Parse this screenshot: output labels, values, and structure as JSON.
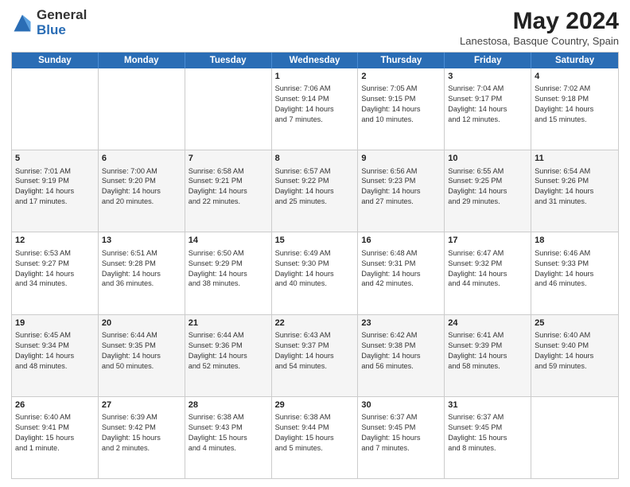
{
  "header": {
    "logo_general": "General",
    "logo_blue": "Blue",
    "title": "May 2024",
    "location": "Lanestosa, Basque Country, Spain"
  },
  "days_of_week": [
    "Sunday",
    "Monday",
    "Tuesday",
    "Wednesday",
    "Thursday",
    "Friday",
    "Saturday"
  ],
  "weeks": [
    {
      "alt": false,
      "cells": [
        {
          "day": "",
          "content": ""
        },
        {
          "day": "",
          "content": ""
        },
        {
          "day": "",
          "content": ""
        },
        {
          "day": "1",
          "content": "Sunrise: 7:06 AM\nSunset: 9:14 PM\nDaylight: 14 hours\nand 7 minutes."
        },
        {
          "day": "2",
          "content": "Sunrise: 7:05 AM\nSunset: 9:15 PM\nDaylight: 14 hours\nand 10 minutes."
        },
        {
          "day": "3",
          "content": "Sunrise: 7:04 AM\nSunset: 9:17 PM\nDaylight: 14 hours\nand 12 minutes."
        },
        {
          "day": "4",
          "content": "Sunrise: 7:02 AM\nSunset: 9:18 PM\nDaylight: 14 hours\nand 15 minutes."
        }
      ]
    },
    {
      "alt": true,
      "cells": [
        {
          "day": "5",
          "content": "Sunrise: 7:01 AM\nSunset: 9:19 PM\nDaylight: 14 hours\nand 17 minutes."
        },
        {
          "day": "6",
          "content": "Sunrise: 7:00 AM\nSunset: 9:20 PM\nDaylight: 14 hours\nand 20 minutes."
        },
        {
          "day": "7",
          "content": "Sunrise: 6:58 AM\nSunset: 9:21 PM\nDaylight: 14 hours\nand 22 minutes."
        },
        {
          "day": "8",
          "content": "Sunrise: 6:57 AM\nSunset: 9:22 PM\nDaylight: 14 hours\nand 25 minutes."
        },
        {
          "day": "9",
          "content": "Sunrise: 6:56 AM\nSunset: 9:23 PM\nDaylight: 14 hours\nand 27 minutes."
        },
        {
          "day": "10",
          "content": "Sunrise: 6:55 AM\nSunset: 9:25 PM\nDaylight: 14 hours\nand 29 minutes."
        },
        {
          "day": "11",
          "content": "Sunrise: 6:54 AM\nSunset: 9:26 PM\nDaylight: 14 hours\nand 31 minutes."
        }
      ]
    },
    {
      "alt": false,
      "cells": [
        {
          "day": "12",
          "content": "Sunrise: 6:53 AM\nSunset: 9:27 PM\nDaylight: 14 hours\nand 34 minutes."
        },
        {
          "day": "13",
          "content": "Sunrise: 6:51 AM\nSunset: 9:28 PM\nDaylight: 14 hours\nand 36 minutes."
        },
        {
          "day": "14",
          "content": "Sunrise: 6:50 AM\nSunset: 9:29 PM\nDaylight: 14 hours\nand 38 minutes."
        },
        {
          "day": "15",
          "content": "Sunrise: 6:49 AM\nSunset: 9:30 PM\nDaylight: 14 hours\nand 40 minutes."
        },
        {
          "day": "16",
          "content": "Sunrise: 6:48 AM\nSunset: 9:31 PM\nDaylight: 14 hours\nand 42 minutes."
        },
        {
          "day": "17",
          "content": "Sunrise: 6:47 AM\nSunset: 9:32 PM\nDaylight: 14 hours\nand 44 minutes."
        },
        {
          "day": "18",
          "content": "Sunrise: 6:46 AM\nSunset: 9:33 PM\nDaylight: 14 hours\nand 46 minutes."
        }
      ]
    },
    {
      "alt": true,
      "cells": [
        {
          "day": "19",
          "content": "Sunrise: 6:45 AM\nSunset: 9:34 PM\nDaylight: 14 hours\nand 48 minutes."
        },
        {
          "day": "20",
          "content": "Sunrise: 6:44 AM\nSunset: 9:35 PM\nDaylight: 14 hours\nand 50 minutes."
        },
        {
          "day": "21",
          "content": "Sunrise: 6:44 AM\nSunset: 9:36 PM\nDaylight: 14 hours\nand 52 minutes."
        },
        {
          "day": "22",
          "content": "Sunrise: 6:43 AM\nSunset: 9:37 PM\nDaylight: 14 hours\nand 54 minutes."
        },
        {
          "day": "23",
          "content": "Sunrise: 6:42 AM\nSunset: 9:38 PM\nDaylight: 14 hours\nand 56 minutes."
        },
        {
          "day": "24",
          "content": "Sunrise: 6:41 AM\nSunset: 9:39 PM\nDaylight: 14 hours\nand 58 minutes."
        },
        {
          "day": "25",
          "content": "Sunrise: 6:40 AM\nSunset: 9:40 PM\nDaylight: 14 hours\nand 59 minutes."
        }
      ]
    },
    {
      "alt": false,
      "cells": [
        {
          "day": "26",
          "content": "Sunrise: 6:40 AM\nSunset: 9:41 PM\nDaylight: 15 hours\nand 1 minute."
        },
        {
          "day": "27",
          "content": "Sunrise: 6:39 AM\nSunset: 9:42 PM\nDaylight: 15 hours\nand 2 minutes."
        },
        {
          "day": "28",
          "content": "Sunrise: 6:38 AM\nSunset: 9:43 PM\nDaylight: 15 hours\nand 4 minutes."
        },
        {
          "day": "29",
          "content": "Sunrise: 6:38 AM\nSunset: 9:44 PM\nDaylight: 15 hours\nand 5 minutes."
        },
        {
          "day": "30",
          "content": "Sunrise: 6:37 AM\nSunset: 9:45 PM\nDaylight: 15 hours\nand 7 minutes."
        },
        {
          "day": "31",
          "content": "Sunrise: 6:37 AM\nSunset: 9:45 PM\nDaylight: 15 hours\nand 8 minutes."
        },
        {
          "day": "",
          "content": ""
        }
      ]
    }
  ]
}
